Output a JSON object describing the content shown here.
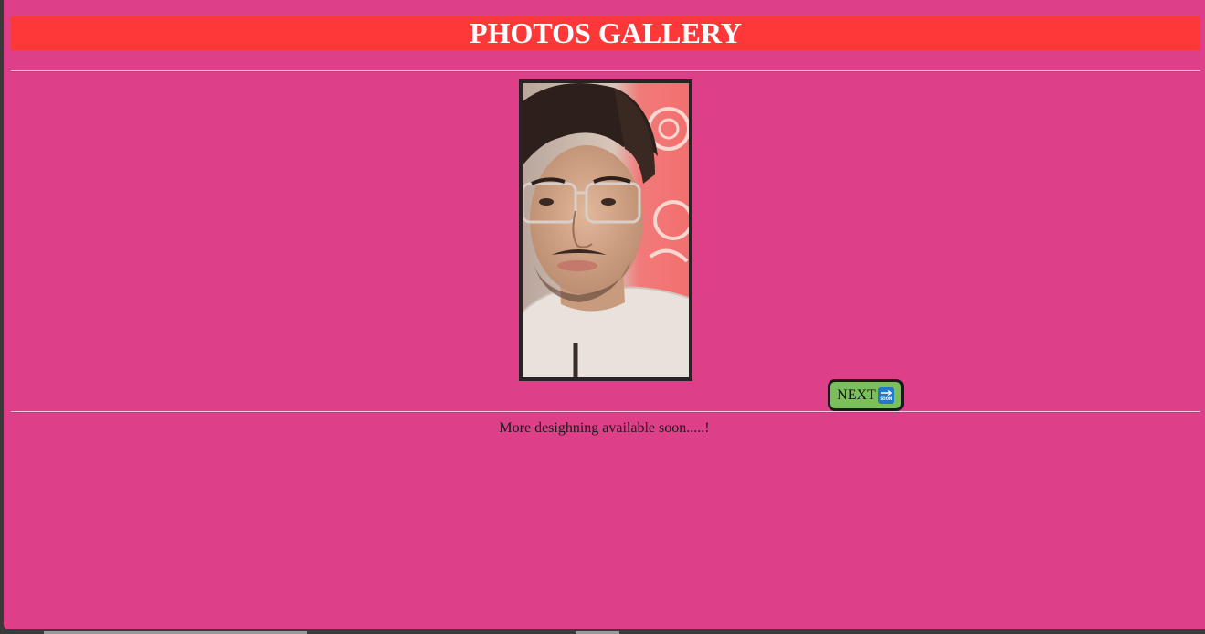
{
  "header": {
    "title": "PHOTOS GALLERY"
  },
  "gallery": {
    "photo_alt": "portrait photo",
    "next_label": "NEXT",
    "next_icon": "soon-arrow-icon",
    "next_icon_text": "SOON"
  },
  "footer": {
    "message": "More desighning available soon.....!"
  },
  "colors": {
    "page_background": "#de3f89",
    "title_background": "#fe3838",
    "title_text": "#ffffff",
    "next_button": "#7bbf5a"
  }
}
